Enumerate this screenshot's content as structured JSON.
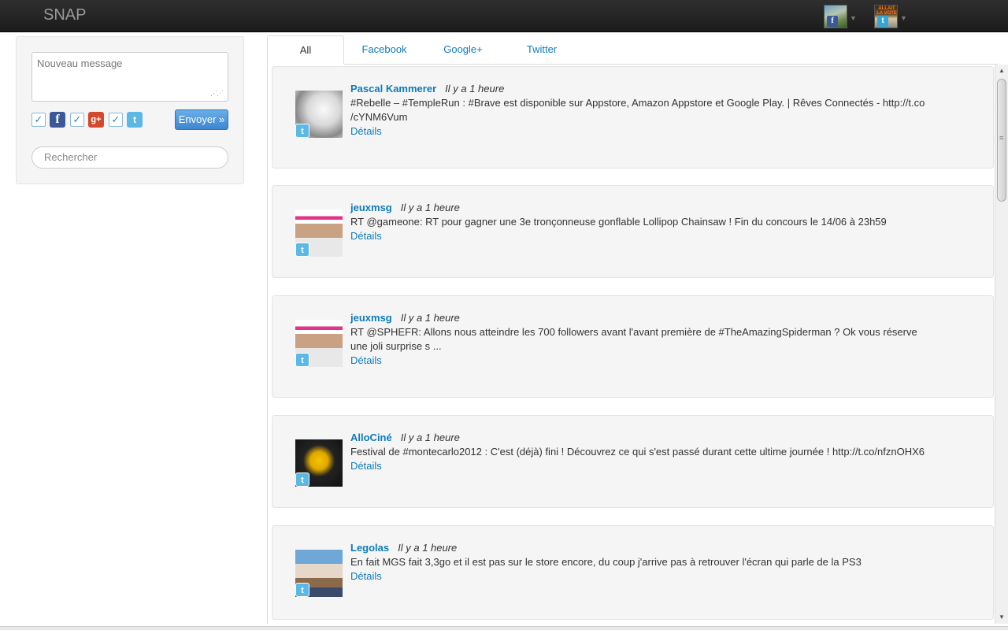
{
  "header": {
    "brand": "SNAP",
    "accounts": [
      {
        "network": "facebook",
        "icon": "facebook-icon"
      },
      {
        "network": "twitter",
        "icon": "twitter-icon",
        "caption": "ALLAIT LA VOTE"
      }
    ]
  },
  "composer": {
    "message_placeholder": "Nouveau message",
    "networks": [
      {
        "name": "Facebook",
        "icon": "facebook-icon",
        "checked": true
      },
      {
        "name": "Google+",
        "icon": "google-plus-icon",
        "checked": true
      },
      {
        "name": "Twitter",
        "icon": "twitter-icon",
        "checked": true
      }
    ],
    "send_label": "Envoyer »",
    "search_placeholder": "Rechercher"
  },
  "tabs": [
    {
      "label": "All",
      "active": true
    },
    {
      "label": "Facebook",
      "active": false
    },
    {
      "label": "Google+",
      "active": false
    },
    {
      "label": "Twitter",
      "active": false
    }
  ],
  "posts": [
    {
      "author": "Pascal Kammerer",
      "time": "Il y a 1 heure",
      "text": "#Rebelle – #TempleRun : #Brave est disponible sur Appstore, Amazon Appstore et Google Play. | Rêves Connectés - http://t.co /cYNM6Vum",
      "details": "Détails",
      "network": "twitter"
    },
    {
      "author": "jeuxmsg",
      "time": "Il y a 1 heure",
      "text": "RT @gameone: RT pour gagner une 3e tronçonneuse gonflable Lollipop Chainsaw ! Fin du concours le 14/06 à 23h59",
      "details": "Détails",
      "network": "twitter"
    },
    {
      "author": "jeuxmsg",
      "time": "Il y a 1 heure",
      "text": "RT @SPHEFR: Allons nous atteindre les 700 followers avant l'avant première de #TheAmazingSpiderman ? Ok vous réserve une joli surprise s ...",
      "details": "Détails",
      "network": "twitter"
    },
    {
      "author": "AlloCiné",
      "time": "Il y a 1 heure",
      "text": "Festival de #montecarlo2012 : C'est (déjà) fini ! Découvrez ce qui s'est passé durant cette ultime journée ! http://t.co/nfznOHX6",
      "details": "Détails",
      "network": "twitter"
    },
    {
      "author": "Legolas",
      "time": "Il y a 1 heure",
      "text": "En fait MGS fait 3,3go et il est pas sur le store encore, du coup j'arrive pas à retrouver l'écran qui parle de la PS3",
      "details": "Détails",
      "network": "twitter"
    }
  ]
}
